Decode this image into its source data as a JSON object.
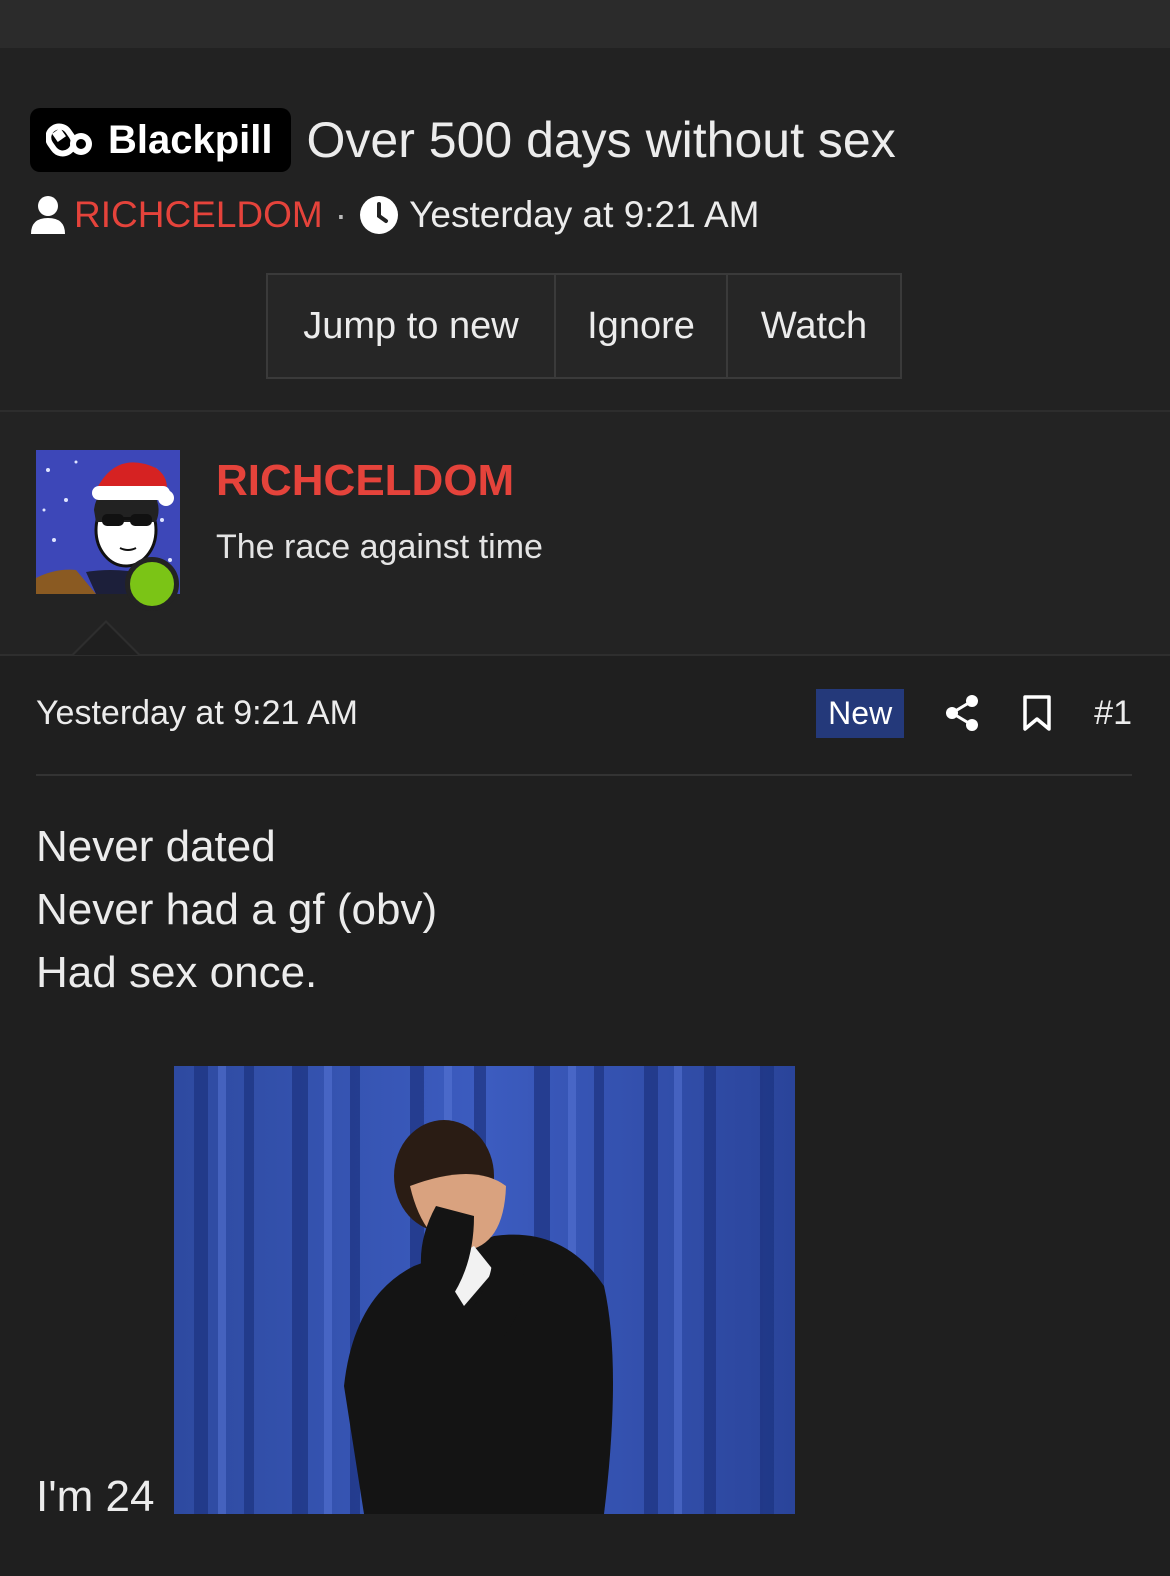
{
  "thread": {
    "prefix_label": "Blackpill",
    "prefix_icon": "pill-icon",
    "title": "Over 500 days without sex",
    "author": "RICHCELDOM",
    "separator": "·",
    "date": "Yesterday at 9:21 AM"
  },
  "actions": {
    "jump_label": "Jump to new",
    "ignore_label": "Ignore",
    "watch_label": "Watch"
  },
  "post": {
    "username": "RICHCELDOM",
    "user_title": "The race against time",
    "date": "Yesterday at 9:21 AM",
    "new_badge": "New",
    "post_number": "#1",
    "lines": [
      "Never dated",
      "Never had a gf (obv)",
      "Had sex once."
    ],
    "last_line": "I'm 24"
  },
  "colors": {
    "accent": "#e5433b",
    "online": "#7bc416",
    "new_badge": "#24397a"
  }
}
